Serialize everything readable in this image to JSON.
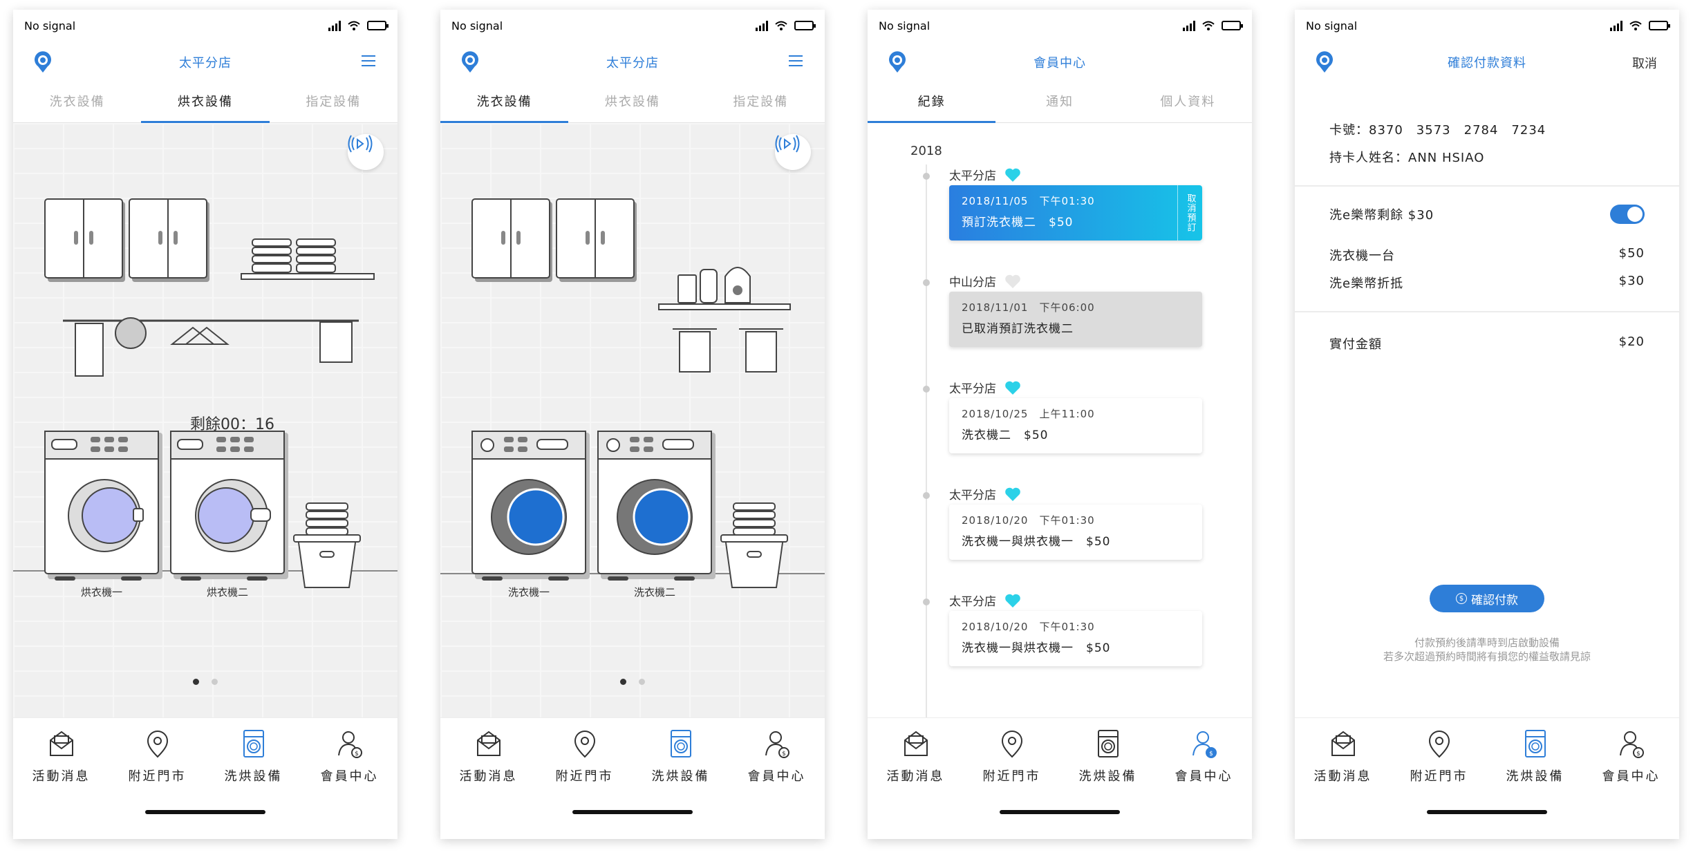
{
  "status": {
    "carrier": "No signal"
  },
  "nav": {
    "items": [
      {
        "label": "活動消息",
        "icon": "mail-icon"
      },
      {
        "label": "附近門市",
        "icon": "location-pin-icon"
      },
      {
        "label": "洗烘設備",
        "icon": "washing-machine-icon"
      },
      {
        "label": "會員中心",
        "icon": "member-icon"
      }
    ]
  },
  "colors": {
    "accent": "#2e7ed8",
    "heart": "#2bd1e8",
    "card_gradient_start": "#2a7ee0",
    "card_gradient_end": "#17c4e8"
  },
  "screen1": {
    "title": "太平分店",
    "tabs": [
      "洗衣設備",
      "烘衣設備",
      "指定設備"
    ],
    "active_tab": "烘衣設備",
    "remaining": "剩餘00：16",
    "machines": [
      "烘衣機一",
      "烘衣機二"
    ]
  },
  "screen2": {
    "title": "太平分店",
    "tabs": [
      "洗衣設備",
      "烘衣設備",
      "指定設備"
    ],
    "active_tab": "洗衣設備",
    "machines": [
      "洗衣機一",
      "洗衣機二"
    ]
  },
  "screen3": {
    "title": "會員中心",
    "tabs": [
      "紀錄",
      "通知",
      "個人資料"
    ],
    "active_tab": "紀錄",
    "year": "2018",
    "records": [
      {
        "store": "太平分店",
        "favorite": true,
        "datetime": "2018/11/05　下午01:30",
        "desc": "預訂洗衣機二　$50",
        "style": "active",
        "cancel": "取消預訂"
      },
      {
        "store": "中山分店",
        "favorite": false,
        "datetime": "2018/11/01　下午06:00",
        "desc": "已取消預訂洗衣機二",
        "style": "cancelled"
      },
      {
        "store": "太平分店",
        "favorite": true,
        "datetime": "2018/10/25　上午11:00",
        "desc": "洗衣機二　$50",
        "style": "normal"
      },
      {
        "store": "太平分店",
        "favorite": true,
        "datetime": "2018/10/20　下午01:30",
        "desc": "洗衣機一與烘衣機一　$50",
        "style": "normal"
      },
      {
        "store": "太平分店",
        "favorite": true,
        "datetime": "2018/10/20　下午01:30",
        "desc": "洗衣機一與烘衣機一　$50",
        "style": "normal"
      }
    ]
  },
  "screen4": {
    "title": "確認付款資料",
    "cancel": "取消",
    "card_number": "卡號：8370　3573　2784　7234",
    "card_holder": "持卡人姓名：ANN HSIAO",
    "balance_label": "洗e樂幣剩餘 $30",
    "balance_toggle": true,
    "items": [
      {
        "label": "洗衣機一台",
        "value": "$50"
      },
      {
        "label": "洗e樂幣折抵",
        "value": "$30"
      }
    ],
    "total_label": "實付金額",
    "total_value": "$20",
    "confirm": "確認付款",
    "note1": "付款預約後請準時到店啟動設備",
    "note2": "若多次超過預約時間將有損您的權益敬請見諒"
  }
}
